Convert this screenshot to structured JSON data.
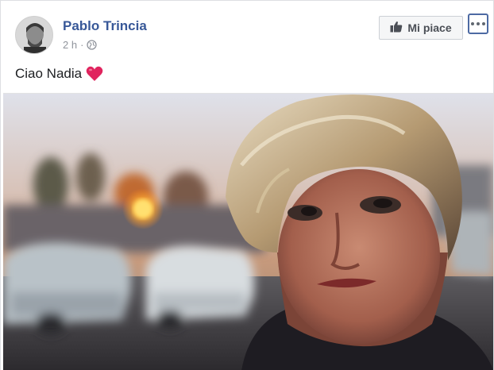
{
  "post": {
    "author": "Pablo Trincia",
    "timestamp": "2 h",
    "separator": "·",
    "privacy_icon": "globe-icon",
    "caption": "Ciao Nadia",
    "caption_emoji": "heart-icon",
    "like_button_label": "Mi piace",
    "more_icon": "more-options-icon",
    "photo_description": "portrait-photo"
  },
  "colors": {
    "author_link": "#385898",
    "meta_text": "#90949c",
    "heart": "#e0245e",
    "more_border": "#4d6aa3"
  }
}
